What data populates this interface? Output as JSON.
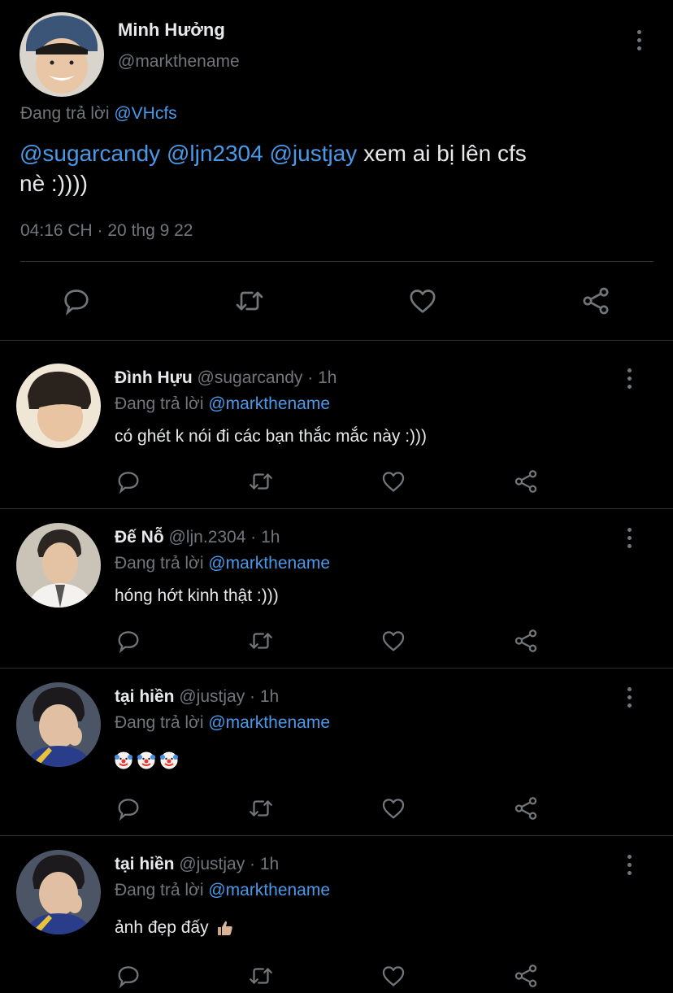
{
  "main_tweet": {
    "name": "Minh Hưởng",
    "handle": "@markthename",
    "replying_prefix": "Đang trả lời",
    "replying_to": "@VHcfs",
    "mentions": [
      "@sugarcandy",
      "@ljn2304",
      "@justjay"
    ],
    "text_rest": "xem ai bị lên cfs",
    "text_line2": "nè :))))",
    "timestamp": "04:16 CH · 20 thg 9 22"
  },
  "replies": [
    {
      "name": "Đình Hựu",
      "handle": "@sugarcandy",
      "time": "· 1h",
      "replying_prefix": "Đang trả lời",
      "replying_to": "@markthename",
      "text": "có ghét k nói đi các bạn thắc mắc này :)))"
    },
    {
      "name": "Đế Nỗ",
      "handle": "@ljn.2304",
      "time": "· 1h",
      "replying_prefix": "Đang trả lời",
      "replying_to": "@markthename",
      "text": "hóng hớt kinh thật :)))"
    },
    {
      "name": "tại hiền",
      "handle": "@justjay",
      "time": "· 1h",
      "replying_prefix": "Đang trả lời",
      "replying_to": "@markthename",
      "text": "",
      "emoji": [
        "clown-face-emoji",
        "clown-face-emoji",
        "clown-face-emoji"
      ]
    },
    {
      "name": "tại hiền",
      "handle": "@justjay",
      "time": "· 1h",
      "replying_prefix": "Đang trả lời",
      "replying_to": "@markthename",
      "text": "ảnh đẹp đấy",
      "emoji": [
        "thumbs-up-emoji"
      ]
    }
  ],
  "icons": {
    "reply": "reply-icon",
    "retweet": "retweet-icon",
    "like": "heart-icon",
    "share": "share-icon",
    "more": "more-icon"
  },
  "colors": {
    "background": "#000000",
    "text": "#e7e9ea",
    "muted": "#71767b",
    "link": "#4a99e9",
    "divider": "#2f3336"
  }
}
